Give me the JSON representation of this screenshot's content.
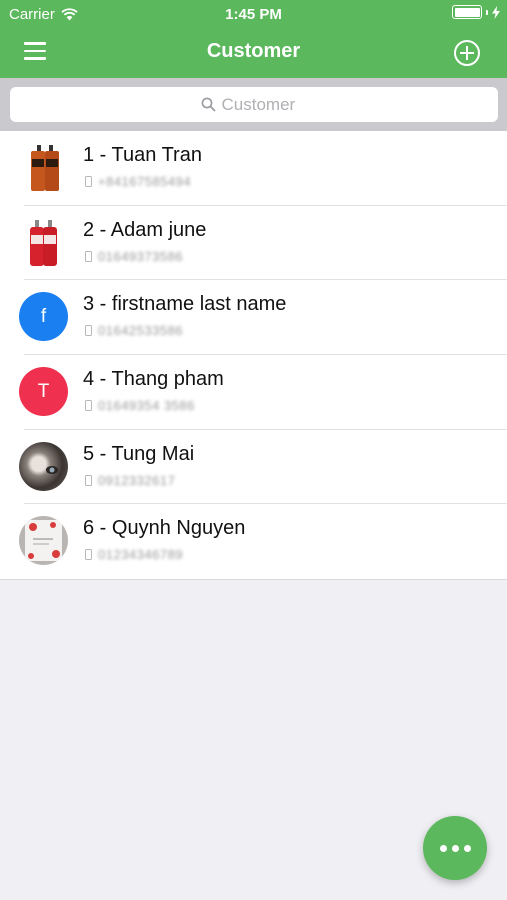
{
  "status_bar": {
    "carrier": "Carrier",
    "time": "1:45 PM"
  },
  "nav": {
    "title": "Customer"
  },
  "search": {
    "placeholder": "Customer"
  },
  "customers": [
    {
      "name": "1 - Tuan Tran",
      "phone": "+84167585494",
      "avatar": "bottles-orange",
      "avatar_color": "#c5561e"
    },
    {
      "name": "2 - Adam june",
      "phone": "01649373586",
      "avatar": "bottles-red",
      "avatar_color": "#d6222c"
    },
    {
      "name": "3 - firstname last name",
      "phone": "01642533586",
      "avatar_letter": "f",
      "avatar_color": "#1a7ff0"
    },
    {
      "name": "4 - Thang pham",
      "phone": "01649354 3586",
      "avatar_letter": "T",
      "avatar_color": "#f0304f"
    },
    {
      "name": "5 - Tung Mai",
      "phone": "0912332617",
      "avatar": "photo-face",
      "avatar_color": "#7d7470"
    },
    {
      "name": "6 - Quynh Nguyen",
      "phone": "01234346789",
      "avatar": "photo-paper",
      "avatar_color": "#d8d0cc"
    }
  ],
  "colors": {
    "primary": "#5cb85c",
    "background": "#efeff4"
  }
}
